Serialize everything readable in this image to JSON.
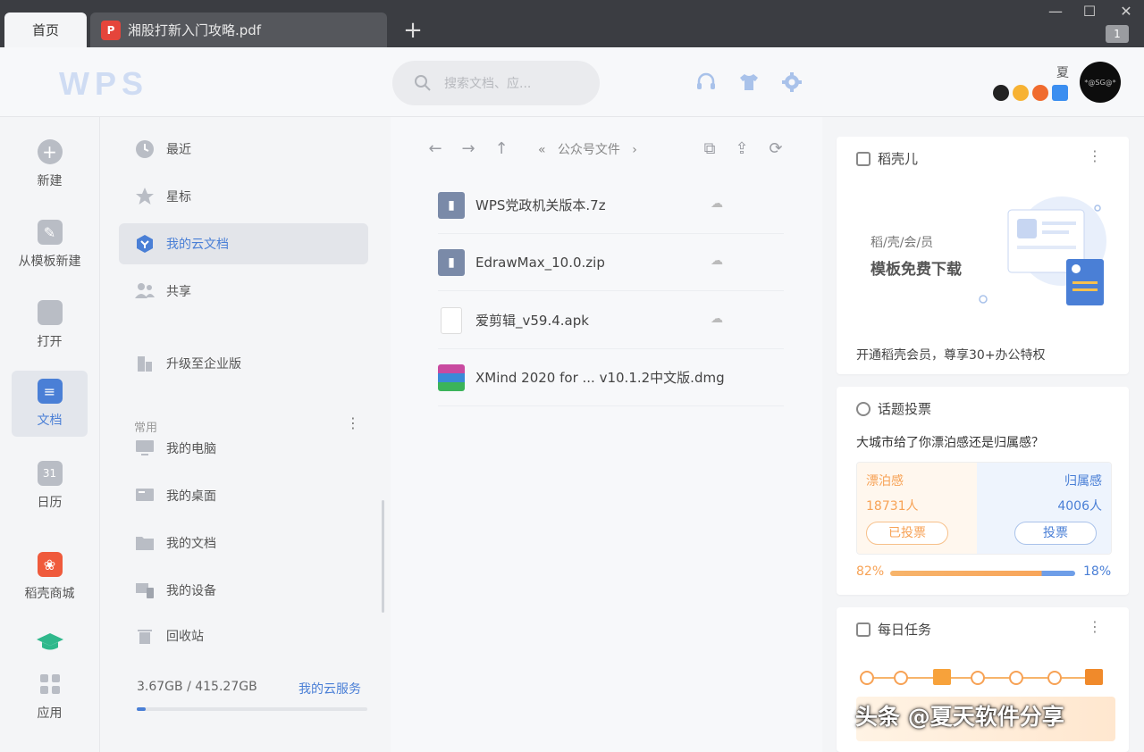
{
  "tabs": {
    "home": "首页",
    "document": "湘股打新入门攻略.pdf",
    "add": "+"
  },
  "window": {
    "badge": "1"
  },
  "header": {
    "logo": "WPS",
    "search_placeholder": "搜索文档、应...",
    "user_name": "夏",
    "avatar_text": "*@SG@*"
  },
  "left_nav": [
    {
      "label": "新建",
      "icon": "plus-circle-icon"
    },
    {
      "label": "从模板新建",
      "icon": "template-icon"
    },
    {
      "label": "打开",
      "icon": "folder-icon"
    },
    {
      "label": "文档",
      "icon": "document-icon",
      "active": true
    },
    {
      "label": "日历",
      "icon": "calendar-icon"
    },
    {
      "label": "稻壳商城",
      "icon": "docer-mall-icon"
    },
    {
      "label": "应用",
      "icon": "apps-icon"
    }
  ],
  "mid_nav": {
    "items": [
      {
        "label": "最近",
        "icon": "clock-icon"
      },
      {
        "label": "星标",
        "icon": "star-icon"
      },
      {
        "label": "我的云文档",
        "icon": "cloud-doc-icon",
        "active": true
      },
      {
        "label": "共享",
        "icon": "share-icon"
      },
      {
        "label": "升级至企业版",
        "icon": "building-icon"
      }
    ],
    "section_title": "常用",
    "section_items": [
      {
        "label": "我的电脑",
        "icon": "computer-icon"
      },
      {
        "label": "我的桌面",
        "icon": "desktop-icon"
      },
      {
        "label": "我的文档",
        "icon": "folder-shortcut-icon"
      },
      {
        "label": "我的设备",
        "icon": "devices-icon"
      },
      {
        "label": "回收站",
        "icon": "trash-icon"
      }
    ],
    "storage_text": "3.67GB / 415.27GB",
    "cloud_service": "我的云服务",
    "storage_used_fraction": 0.009
  },
  "file_area": {
    "breadcrumb": "公众号文件",
    "files": [
      {
        "name": "WPS党政机关版本.7z",
        "icon": "archive-icon"
      },
      {
        "name": "EdrawMax_10.0.zip",
        "icon": "archive-icon"
      },
      {
        "name": "爱剪辑_v59.4.apk",
        "icon": "file-icon"
      },
      {
        "name": "XMind 2020 for ... v10.1.2中文版.dmg",
        "icon": "winrar-icon"
      }
    ]
  },
  "right_panel": {
    "docer": {
      "title": "稻壳儿",
      "banner_sub": "稻/壳/会/员",
      "banner_main": "模板免费下载",
      "footer": "开通稻壳会员，尊享30+办公特权"
    },
    "vote": {
      "title": "话题投票",
      "question": "大城市给了你漂泊感还是归属感？",
      "left_label": "漂泊感",
      "left_count": "18731人",
      "left_button": "已投票",
      "right_label": "归属感",
      "right_count": "4006人",
      "right_button": "投票",
      "left_pct": "82%",
      "right_pct": "18%",
      "left_fraction": 0.82
    },
    "daily": {
      "title": "每日任务"
    }
  },
  "watermark": "头条 @夏天软件分享",
  "colors": {
    "accent": "#4a7fd6",
    "titlebar": "#3b3d42",
    "orange": "#f7a255"
  }
}
